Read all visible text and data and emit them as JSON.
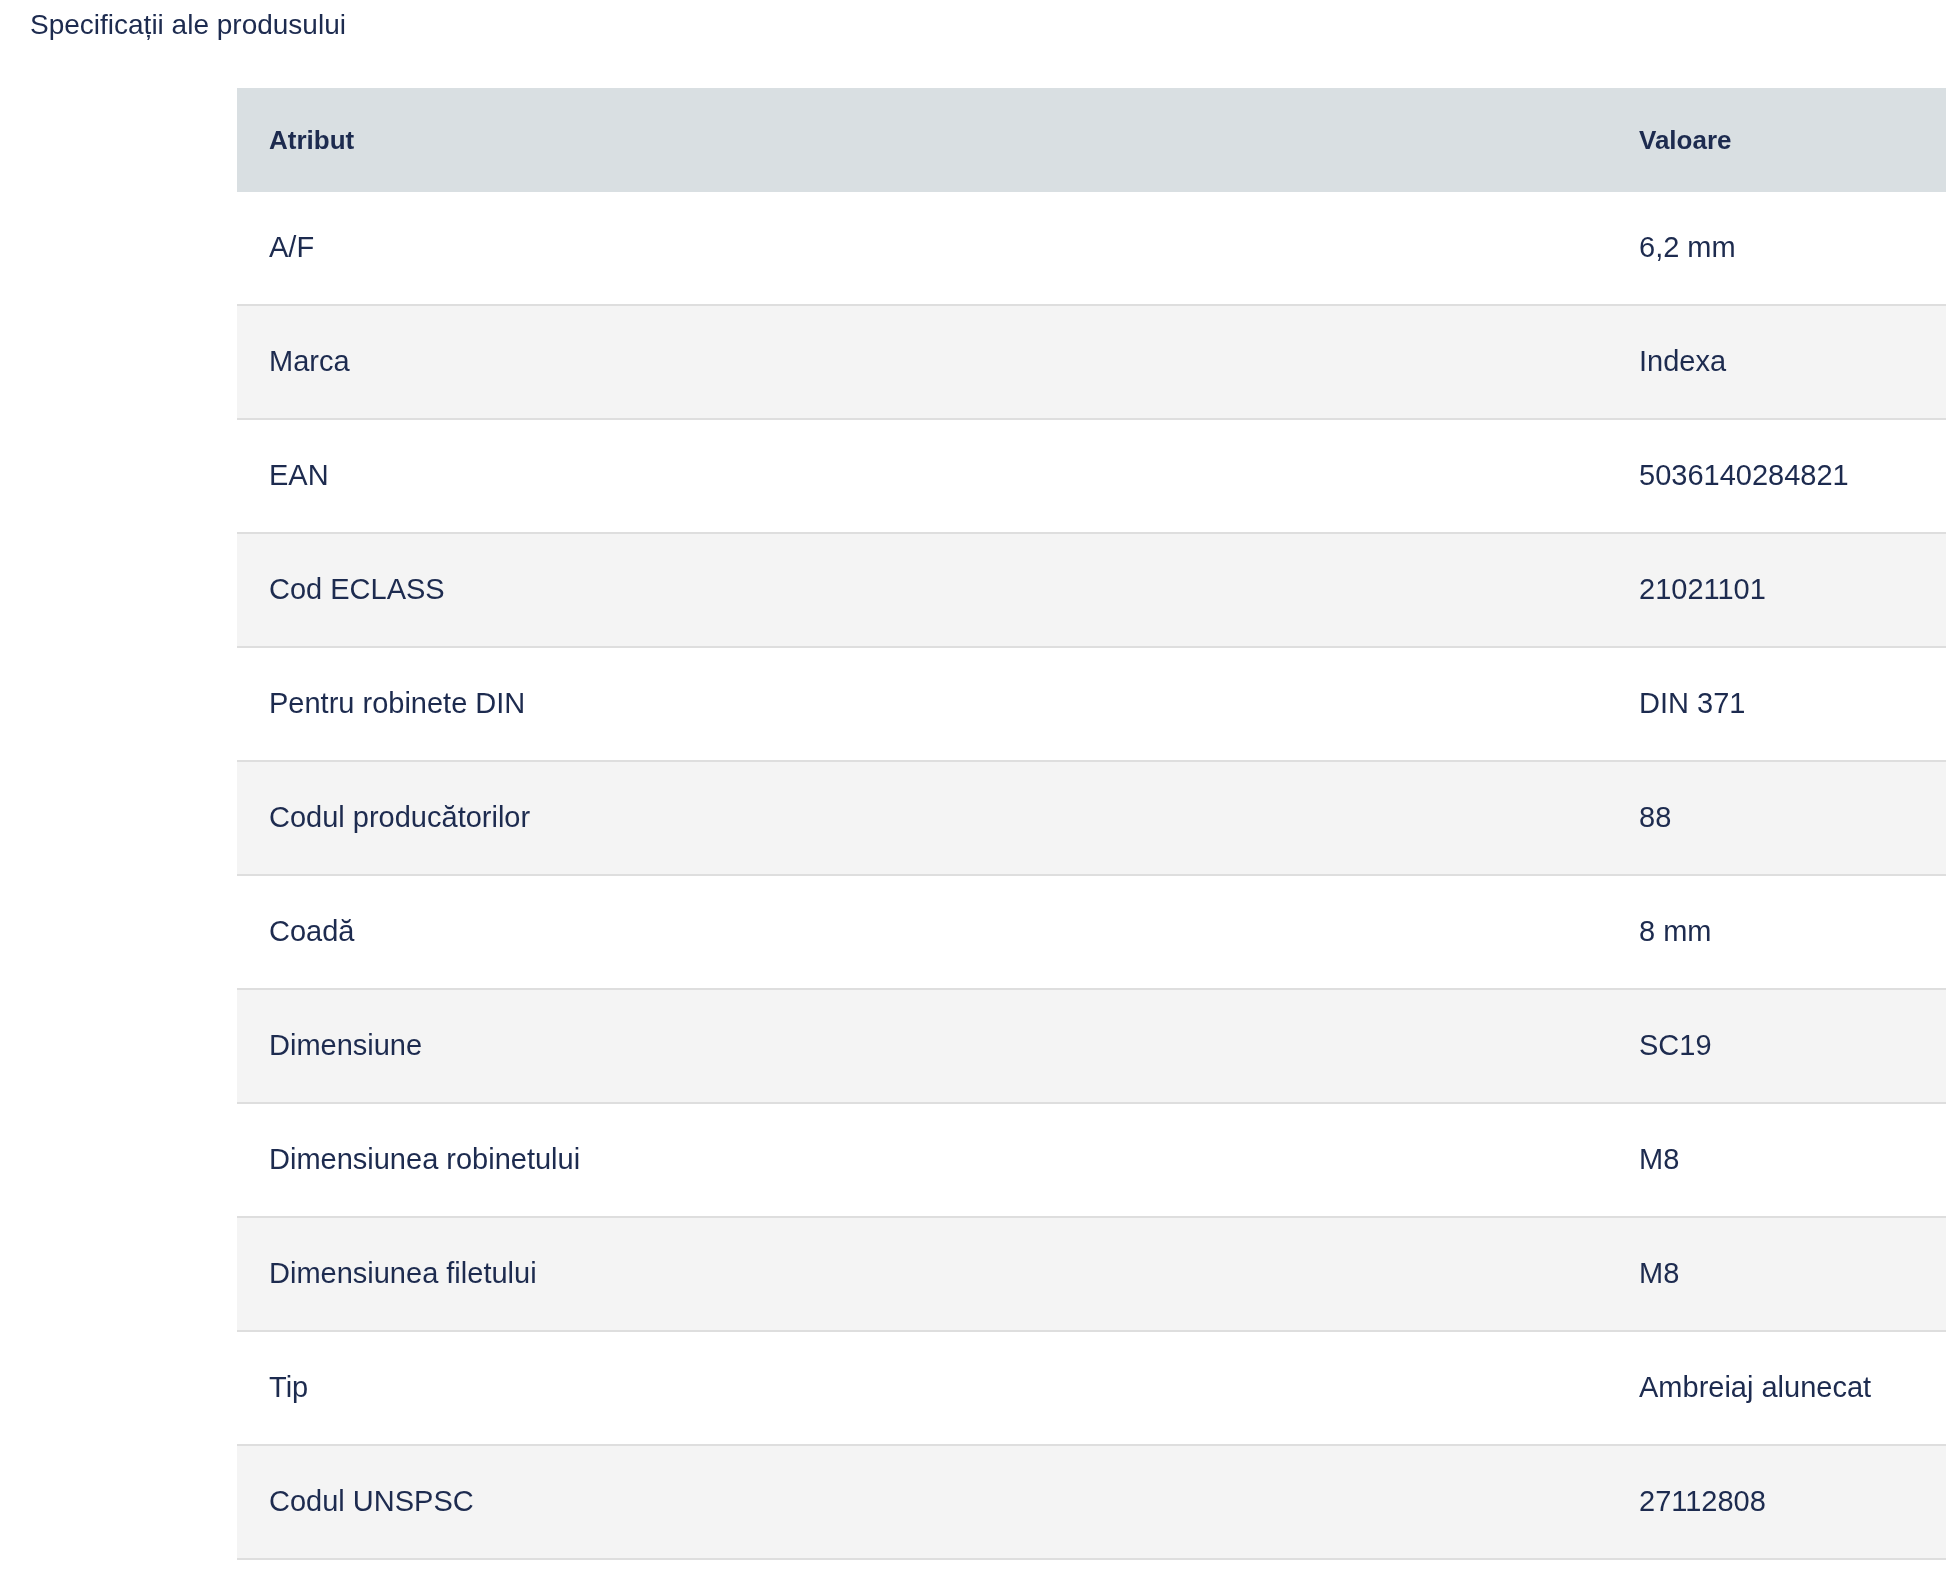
{
  "title": "Specificații ale produsului",
  "table": {
    "columns": [
      "Atribut",
      "Valoare"
    ],
    "rows": [
      [
        "A/F",
        "6,2 mm"
      ],
      [
        "Marca",
        "Indexa"
      ],
      [
        "EAN",
        "5036140284821"
      ],
      [
        "Cod ECLASS",
        "21021101"
      ],
      [
        "Pentru robinete DIN",
        "DIN 371"
      ],
      [
        "Codul producătorilor",
        "88"
      ],
      [
        "Coadă",
        "8 mm"
      ],
      [
        "Dimensiune",
        "SC19"
      ],
      [
        "Dimensiunea robinetului",
        "M8"
      ],
      [
        "Dimensiunea filetului",
        "M8"
      ],
      [
        "Tip",
        "Ambreiaj alunecat"
      ],
      [
        "Codul UNSPSC",
        "27112808"
      ]
    ]
  }
}
